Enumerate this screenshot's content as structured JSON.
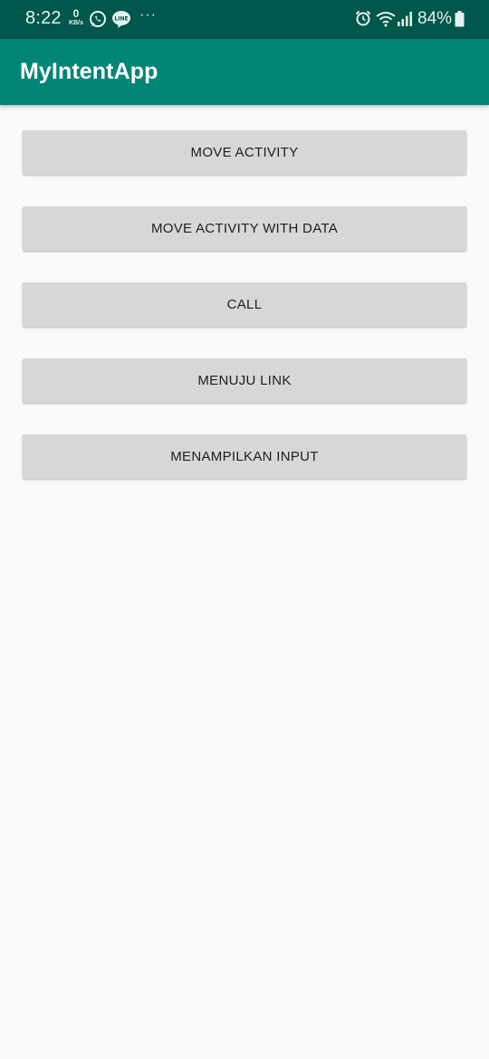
{
  "status_bar": {
    "time": "8:22",
    "net_speed_value": "0",
    "net_speed_unit": "KB/s",
    "more": "···",
    "battery": "84%",
    "icons": [
      "whatsapp-icon",
      "line-icon",
      "alarm-icon",
      "wifi-icon",
      "signal-icon",
      "battery-icon"
    ]
  },
  "app_bar": {
    "title": "MyIntentApp"
  },
  "buttons": [
    {
      "label": "MOVE ACTIVITY"
    },
    {
      "label": "MOVE ACTIVITY WITH DATA"
    },
    {
      "label": "CALL"
    },
    {
      "label": "MENUJU LINK"
    },
    {
      "label": "MENAMPILKAN INPUT"
    }
  ],
  "colors": {
    "status_bar": "#00574b",
    "app_bar": "#008577",
    "button_bg": "#d6d7d7",
    "background": "#fafafa"
  }
}
